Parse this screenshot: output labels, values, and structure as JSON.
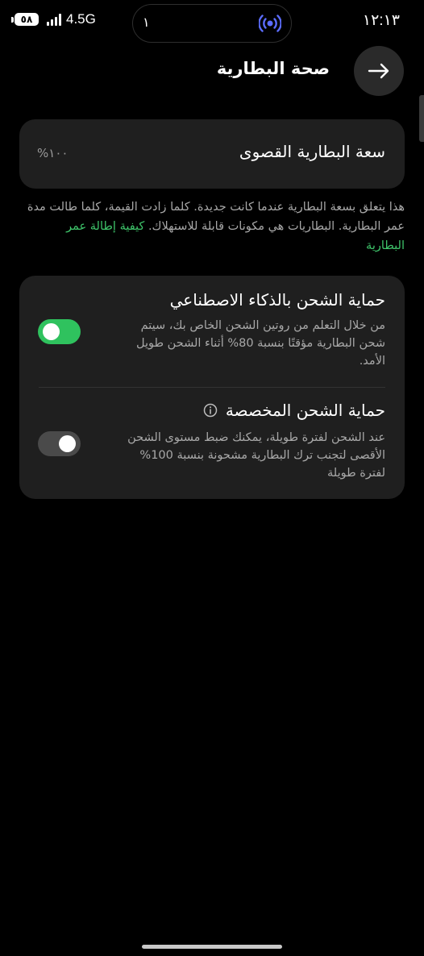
{
  "status_bar": {
    "battery_level": "٥٨",
    "network": "4.5G",
    "pill_text": "١",
    "time": "١٢:١٣"
  },
  "header": {
    "title": "صحة البطارية"
  },
  "capacity_card": {
    "label": "سعة البطارية القصوى",
    "value": "١٠٠%"
  },
  "description": {
    "text": "هذا يتعلق بسعة البطارية عندما كانت جديدة. كلما زادت القيمة، كلما طالت مدة عمر البطارية. البطاريات هي مكونات قابلة للاستهلاك. ",
    "link": "كيفية إطالة عمر البطارية"
  },
  "settings": {
    "ai_protection": {
      "title": "حماية الشحن بالذكاء الاصطناعي",
      "description": "من خلال التعلم من روتين الشحن الخاص بك، سيتم شحن البطارية مؤقتًا بنسبة 80% أثناء الشحن طويل الأمد.",
      "enabled": true
    },
    "custom_protection": {
      "title": "حماية الشحن المخصصة",
      "description": "عند الشحن لفترة طويلة، يمكنك ضبط مستوى الشحن الأقصى لتجنب ترك البطارية مشحونة بنسبة 100% لفترة طويلة",
      "enabled": false
    }
  },
  "colors": {
    "accent_green": "#2fc25e",
    "link_green": "#3ec46a",
    "card_bg": "#1f1f1f"
  }
}
